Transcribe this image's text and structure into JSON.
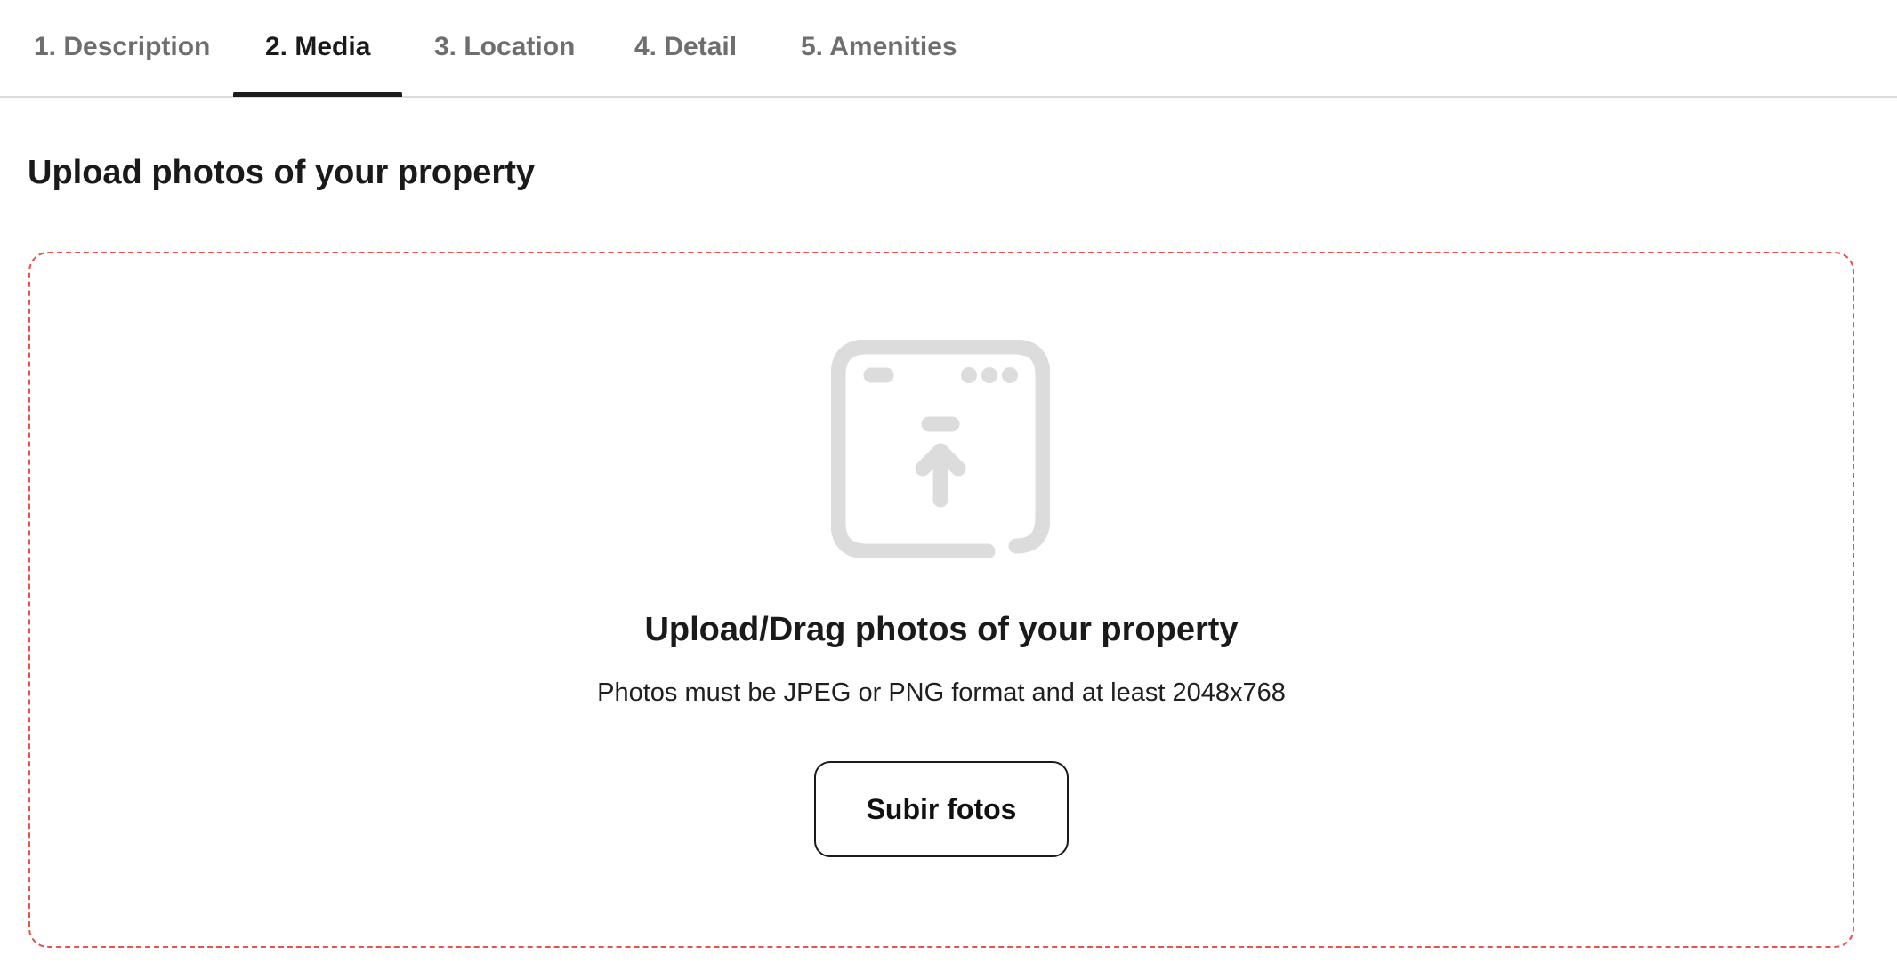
{
  "tabs": [
    {
      "label": "1. Description",
      "active": false
    },
    {
      "label": "2. Media",
      "active": true
    },
    {
      "label": "3. Location",
      "active": false
    },
    {
      "label": "4. Detail",
      "active": false
    },
    {
      "label": "5. Amenities",
      "active": false
    }
  ],
  "section": {
    "title": "Upload photos of your property"
  },
  "dropzone": {
    "icon": "upload-window-icon",
    "title": "Upload/Drag photos of your property",
    "subtitle": "Photos must be JPEG or PNG format and at least 2048x768",
    "button_label": "Subir fotos"
  },
  "colors": {
    "dropzone_border": "#e5534b",
    "icon": "#dcdcdc",
    "active_tab": "#1a1a1a",
    "inactive_tab": "#6e6e6e"
  }
}
